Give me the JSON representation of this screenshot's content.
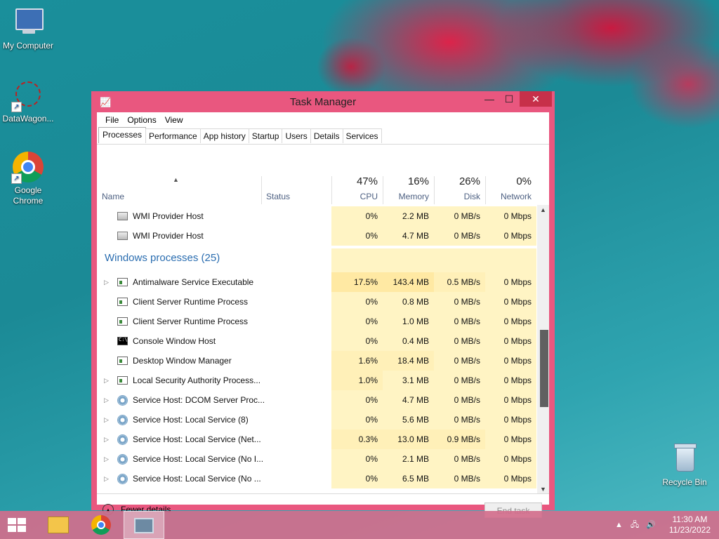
{
  "desktop": {
    "icons": [
      {
        "label": "My Computer",
        "icon": "computer-icon"
      },
      {
        "label": "DataWagon...",
        "icon": "datawagon-icon"
      },
      {
        "label": "Google Chrome",
        "icon": "chrome-icon"
      },
      {
        "label": "Recycle Bin",
        "icon": "recycle-bin-icon"
      }
    ]
  },
  "window": {
    "title": "Task Manager",
    "controls": {
      "minimize": "—",
      "maximize": "☐",
      "close": "✕"
    }
  },
  "menu": [
    "File",
    "Options",
    "View"
  ],
  "tabs": [
    "Processes",
    "Performance",
    "App history",
    "Startup",
    "Users",
    "Details",
    "Services"
  ],
  "active_tab": "Processes",
  "columns": {
    "name": "Name",
    "status": "Status",
    "cpu": {
      "pct": "47%",
      "label": "CPU"
    },
    "memory": {
      "pct": "16%",
      "label": "Memory"
    },
    "disk": {
      "pct": "26%",
      "label": "Disk"
    },
    "network": {
      "pct": "0%",
      "label": "Network"
    }
  },
  "rows": [
    {
      "name": "WMI Provider Host",
      "icon": "wmi",
      "expand": false,
      "cpu": "0%",
      "memory": "2.2 MB",
      "disk": "0 MB/s",
      "network": "0 Mbps"
    },
    {
      "name": "WMI Provider Host",
      "icon": "wmi",
      "expand": false,
      "cpu": "0%",
      "memory": "4.7 MB",
      "disk": "0 MB/s",
      "network": "0 Mbps"
    },
    {
      "group": "Windows processes (25)"
    },
    {
      "name": "Antimalware Service Executable",
      "icon": "win",
      "expand": true,
      "cpu": "17.5%",
      "memory": "143.4 MB",
      "disk": "0.5 MB/s",
      "network": "0 Mbps"
    },
    {
      "name": "Client Server Runtime Process",
      "icon": "win",
      "expand": false,
      "cpu": "0%",
      "memory": "0.8 MB",
      "disk": "0 MB/s",
      "network": "0 Mbps"
    },
    {
      "name": "Client Server Runtime Process",
      "icon": "win",
      "expand": false,
      "cpu": "0%",
      "memory": "1.0 MB",
      "disk": "0 MB/s",
      "network": "0 Mbps"
    },
    {
      "name": "Console Window Host",
      "icon": "con",
      "expand": false,
      "cpu": "0%",
      "memory": "0.4 MB",
      "disk": "0 MB/s",
      "network": "0 Mbps"
    },
    {
      "name": "Desktop Window Manager",
      "icon": "win",
      "expand": false,
      "cpu": "1.6%",
      "memory": "18.4 MB",
      "disk": "0 MB/s",
      "network": "0 Mbps"
    },
    {
      "name": "Local Security Authority Process...",
      "icon": "win",
      "expand": true,
      "cpu": "1.0%",
      "memory": "3.1 MB",
      "disk": "0 MB/s",
      "network": "0 Mbps"
    },
    {
      "name": "Service Host: DCOM Server Proc...",
      "icon": "gear",
      "expand": true,
      "cpu": "0%",
      "memory": "4.7 MB",
      "disk": "0 MB/s",
      "network": "0 Mbps"
    },
    {
      "name": "Service Host: Local Service (8)",
      "icon": "gear",
      "expand": true,
      "cpu": "0%",
      "memory": "5.6 MB",
      "disk": "0 MB/s",
      "network": "0 Mbps"
    },
    {
      "name": "Service Host: Local Service (Net...",
      "icon": "gear",
      "expand": true,
      "cpu": "0.3%",
      "memory": "13.0 MB",
      "disk": "0.9 MB/s",
      "network": "0 Mbps"
    },
    {
      "name": "Service Host: Local Service (No I...",
      "icon": "gear",
      "expand": true,
      "cpu": "0%",
      "memory": "2.1 MB",
      "disk": "0 MB/s",
      "network": "0 Mbps"
    },
    {
      "name": "Service Host: Local Service (No ...",
      "icon": "gear",
      "expand": true,
      "cpu": "0%",
      "memory": "6.5 MB",
      "disk": "0 MB/s",
      "network": "0 Mbps"
    }
  ],
  "footer": {
    "fewer_details": "Fewer details",
    "end_task": "End task"
  },
  "taskbar": {
    "items": [
      "start-button",
      "file-explorer",
      "google-chrome",
      "task-manager"
    ],
    "time": "11:30 AM",
    "date": "11/23/2022"
  }
}
